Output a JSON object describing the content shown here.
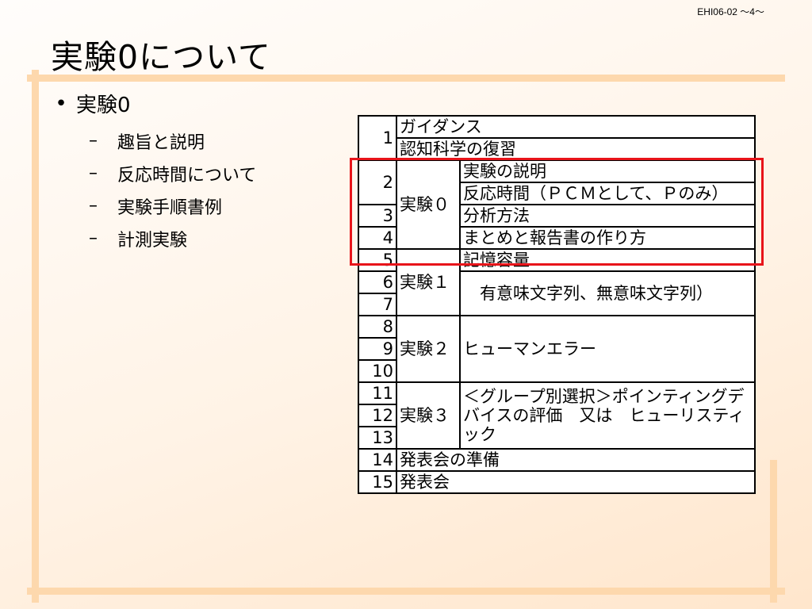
{
  "slide": {
    "number": "EHI06-02 ～4～",
    "title": "実験0について"
  },
  "bullets": {
    "main": "実験0",
    "subs": [
      "趣旨と説明",
      "反応時間について",
      "実験手順書例",
      "計測実験"
    ]
  },
  "schedule": {
    "n": [
      "1",
      "2",
      "3",
      "4",
      "5",
      "6",
      "7",
      "8",
      "9",
      "10",
      "11",
      "12",
      "13",
      "14",
      "15"
    ],
    "groups": {
      "g0": "実験０",
      "g1": "実験１",
      "g2": "実験２",
      "g3": "実験３"
    },
    "items": {
      "r1a": "ガイダンス",
      "r1b": "認知科学の復習",
      "r2a": "実験の説明",
      "r2b": "反応時間（ＰＣＭとして、Ｐのみ）",
      "r3": "分析方法",
      "r4": "まとめと報告書の作り方",
      "r5a": "記憶容量",
      "r5b": "　有意味文字列、無意味文字列）",
      "r8": "ヒューマンエラー",
      "r11": "＜グループ別選択＞ポインティングデバイスの評価　又は　ヒューリスティック",
      "r14": "発表会の準備",
      "r15": "発表会"
    }
  },
  "highlight_color": "#e8141a"
}
